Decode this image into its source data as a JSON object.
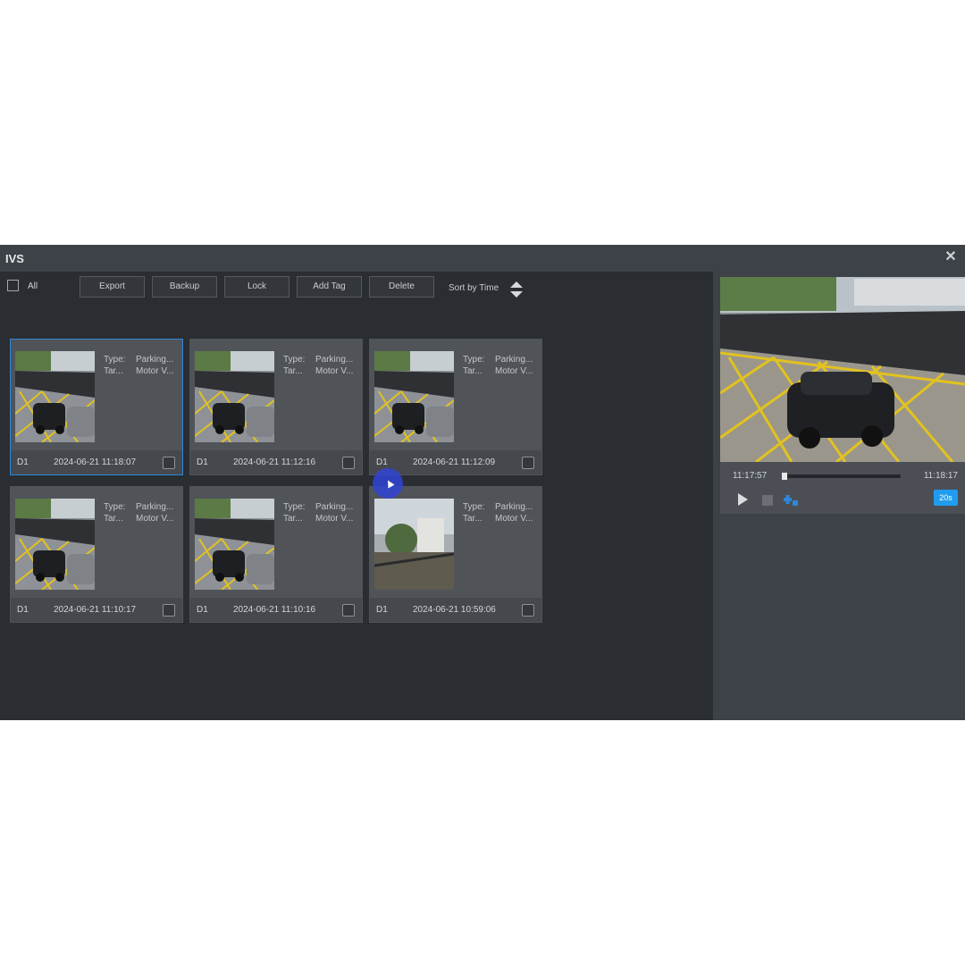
{
  "window": {
    "title": "IVS",
    "close_glyph": "✕"
  },
  "toolbar": {
    "all_label": "All",
    "buttons": [
      "Export",
      "Backup",
      "Lock",
      "Add Tag",
      "Delete"
    ],
    "sort_label": "Sort by Time"
  },
  "cards": [
    {
      "type_key": "Type:",
      "type_val": "Parking...",
      "target_key": "Tar...",
      "target_val": "Motor V...",
      "channel": "D1",
      "time": "2024-06-21 11:18:07",
      "selected": true
    },
    {
      "type_key": "Type:",
      "type_val": "Parking...",
      "target_key": "Tar...",
      "target_val": "Motor V...",
      "channel": "D1",
      "time": "2024-06-21 11:12:16",
      "selected": false
    },
    {
      "type_key": "Type:",
      "type_val": "Parking...",
      "target_key": "Tar...",
      "target_val": "Motor V...",
      "channel": "D1",
      "time": "2024-06-21 11:12:09",
      "selected": false
    },
    {
      "type_key": "Type:",
      "type_val": "Parking...",
      "target_key": "Tar...",
      "target_val": "Motor V...",
      "channel": "D1",
      "time": "2024-06-21 11:10:17",
      "selected": false
    },
    {
      "type_key": "Type:",
      "type_val": "Parking...",
      "target_key": "Tar...",
      "target_val": "Motor V...",
      "channel": "D1",
      "time": "2024-06-21 11:10:16",
      "selected": false
    },
    {
      "type_key": "Type:",
      "type_val": "Parking...",
      "target_key": "Tar...",
      "target_val": "Motor V...",
      "channel": "D1",
      "time": "2024-06-21 10:59:06",
      "selected": false
    }
  ],
  "player": {
    "start_time": "11:17:57",
    "end_time": "11:18:17",
    "progress": 0.0,
    "speed_label": "20s"
  },
  "icons": {
    "close": "close-icon",
    "sort": "sort-arrows-icon",
    "play": "play-icon",
    "stop": "stop-icon",
    "clip": "clip-icon"
  },
  "colors": {
    "accent": "#1f9cf0",
    "selection": "#2f86d9",
    "lines": "#e2c21f"
  }
}
